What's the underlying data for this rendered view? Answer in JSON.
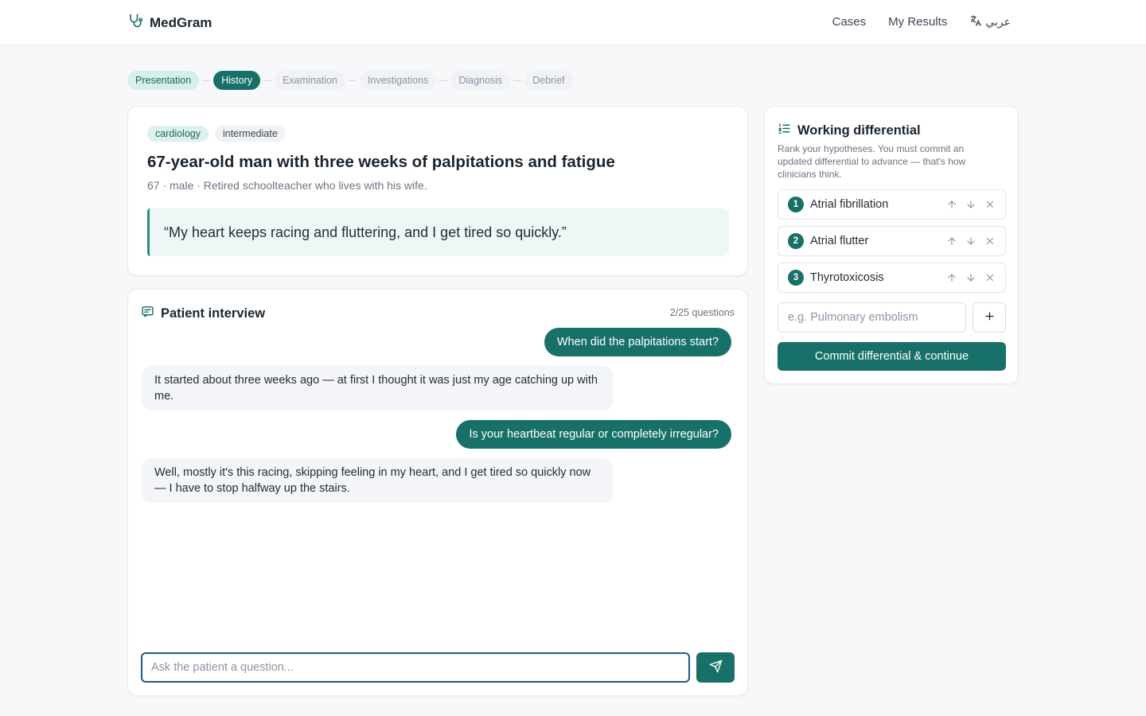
{
  "header": {
    "brand": "MedGram",
    "nav": [
      "Cases",
      "My Results"
    ],
    "language": "عربي"
  },
  "stepper": [
    {
      "label": "Presentation",
      "state": "done"
    },
    {
      "label": "History",
      "state": "active"
    },
    {
      "label": "Examination",
      "state": "pending"
    },
    {
      "label": "Investigations",
      "state": "pending"
    },
    {
      "label": "Diagnosis",
      "state": "pending"
    },
    {
      "label": "Debrief",
      "state": "pending"
    }
  ],
  "case": {
    "specialty": "cardiology",
    "level": "intermediate",
    "title": "67-year-old man with three weeks of palpitations and fatigue",
    "subtitle": "67 · male · Retired schoolteacher who lives with his wife.",
    "quote": "“My heart keeps racing and fluttering, and I get tired so quickly.”"
  },
  "interview": {
    "title": "Patient interview",
    "question_count": "2/25 questions",
    "messages": [
      {
        "role": "user",
        "text": "When did the palpitations start?"
      },
      {
        "role": "patient",
        "text": "It started about three weeks ago — at first I thought it was just my age catching up with me."
      },
      {
        "role": "user",
        "text": "Is your heartbeat regular or completely irregular?"
      },
      {
        "role": "patient",
        "text": "Well, mostly it's this racing, skipping feeling in my heart, and I get tired so quickly now — I have to stop halfway up the stairs."
      }
    ],
    "input_placeholder": "Ask the patient a question..."
  },
  "differential": {
    "title": "Working differential",
    "description": "Rank your hypotheses. You must commit an updated differential to advance — that's how clinicians think.",
    "items": [
      {
        "rank": "1",
        "name": "Atrial fibrillation"
      },
      {
        "rank": "2",
        "name": "Atrial flutter"
      },
      {
        "rank": "3",
        "name": "Thyrotoxicosis"
      }
    ],
    "add_placeholder": "e.g. Pulmonary embolism",
    "commit_label": "Commit differential & continue"
  },
  "colors": {
    "accent": "#187168",
    "accent_light": "#d7efea",
    "focus_border": "#1f5a86"
  },
  "icons": {
    "brand": "stethoscope-icon",
    "language": "translate-icon",
    "interview": "message-square-icon",
    "differential": "list-ordered-icon",
    "send": "send-icon",
    "add": "plus-icon",
    "move_up": "arrow-up-icon",
    "move_down": "arrow-down-icon",
    "remove": "x-icon"
  }
}
